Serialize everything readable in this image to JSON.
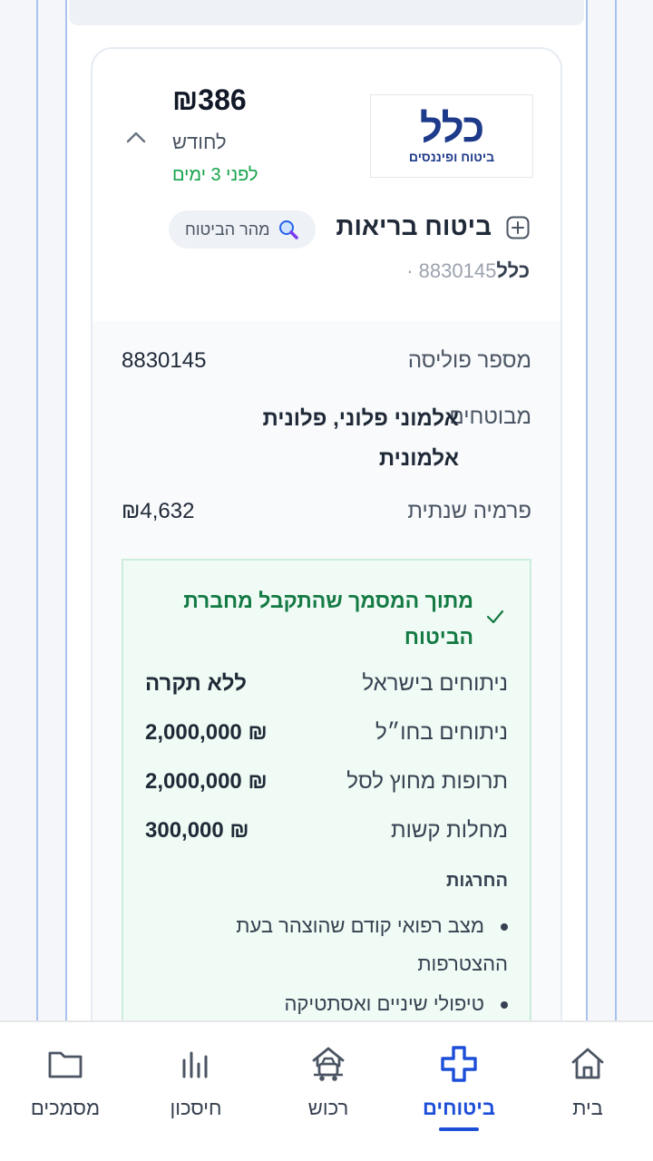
{
  "policy_card": {
    "company_logo_main": "כלל",
    "company_logo_sub": "ביטוח ופיננסים",
    "monthly_amount": "₪386",
    "period": "לחודש",
    "updated_ago": "לפני 3 ימים",
    "title": "ביטוח בריאות",
    "source_pill": "מהר הביטוח",
    "company_name": "כלל",
    "policy_number_short": "8830145",
    "separator": "·"
  },
  "details": {
    "policy_number_label": "מספר פוליסה",
    "policy_number_value": "8830145",
    "insured_label": "מבוטחים",
    "insured_value": "אלמוני פלוני, פלונית אלמונית",
    "annual_premium_label": "פרמיה שנתית",
    "annual_premium_value": "₪4,632"
  },
  "document_box": {
    "title": "מתוך המסמך שהתקבל מחברת הביטוח",
    "coverages": [
      {
        "label": "ניתוחים בישראל",
        "value": "ללא תקרה"
      },
      {
        "label": "ניתוחים בחו״ל",
        "value": "₪ 2,000,000"
      },
      {
        "label": "תרופות מחוץ לסל",
        "value": "₪ 2,000,000"
      },
      {
        "label": "מחלות קשות",
        "value": "₪ 300,000"
      }
    ],
    "exclusions_title": "החרגות",
    "exclusions": [
      "מצב רפואי קודם שהוצהר בעת ההצטרפות",
      "טיפולי שיניים ואסתטיקה"
    ]
  },
  "bottom_nav": {
    "items": [
      {
        "label": "בית",
        "icon": "home-icon"
      },
      {
        "label": "ביטוחים",
        "icon": "health-cross-icon",
        "active": true
      },
      {
        "label": "רכוש",
        "icon": "property-icon"
      },
      {
        "label": "חיסכון",
        "icon": "savings-chart-icon"
      },
      {
        "label": "מסמכים",
        "icon": "folder-icon"
      }
    ]
  },
  "colors": {
    "accent": "#1d4ed8",
    "success": "#15a34a",
    "success_dark": "#147a44",
    "brand_logo": "#1e3a8a"
  }
}
